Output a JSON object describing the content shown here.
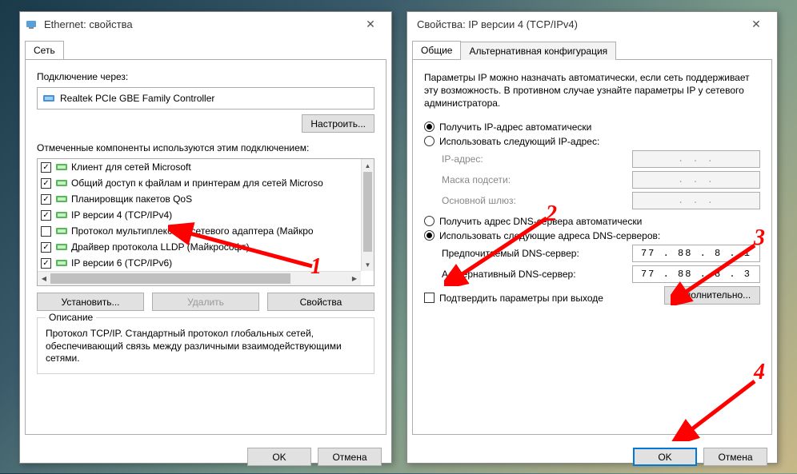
{
  "left": {
    "title": "Ethernet: свойства",
    "tab": "Сеть",
    "connect_label": "Подключение через:",
    "adapter": "Realtek PCIe GBE Family Controller",
    "configure_btn": "Настроить...",
    "components_label": "Отмеченные компоненты используются этим подключением:",
    "items": [
      {
        "chk": true,
        "label": "Клиент для сетей Microsoft"
      },
      {
        "chk": true,
        "label": "Общий доступ к файлам и принтерам для сетей Microso"
      },
      {
        "chk": true,
        "label": "Планировщик пакетов QoS"
      },
      {
        "chk": true,
        "label": "IP версии 4 (TCP/IPv4)"
      },
      {
        "chk": false,
        "label": "Протокол мультиплексора сетевого адаптера (Майкро"
      },
      {
        "chk": true,
        "label": "Драйвер протокола LLDP (Майкрософт)"
      },
      {
        "chk": true,
        "label": "IP версии 6 (TCP/IPv6)"
      }
    ],
    "install_btn": "Установить...",
    "remove_btn": "Удалить",
    "props_btn": "Свойства",
    "desc_title": "Описание",
    "desc_text": "Протокол TCP/IP. Стандартный протокол глобальных сетей, обеспечивающий связь между различными взаимодействующими сетями.",
    "ok": "OK",
    "cancel": "Отмена"
  },
  "right": {
    "title": "Свойства: IP версии 4 (TCP/IPv4)",
    "tab1": "Общие",
    "tab2": "Альтернативная конфигурация",
    "info": "Параметры IP можно назначать автоматически, если сеть поддерживает эту возможность. В противном случае узнайте параметры IP у сетевого администратора.",
    "r_ip_auto": "Получить IP-адрес автоматически",
    "r_ip_manual": "Использовать следующий IP-адрес:",
    "ip_label": "IP-адрес:",
    "mask_label": "Маска подсети:",
    "gw_label": "Основной шлюз:",
    "ip_dots": ".       .       .",
    "r_dns_auto": "Получить адрес DNS-сервера автоматически",
    "r_dns_manual": "Использовать следующие адреса DNS-серверов:",
    "dns1_label": "Предпочитаемый DNS-сервер:",
    "dns2_label": "Альтернативный DNS-сервер:",
    "dns1_value": "77 . 88 .  8  .  1",
    "dns2_value": "77 . 88 .  8  .  3",
    "confirm_chk": "Подтвердить параметры при выходе",
    "advanced_btn": "Дополнительно...",
    "ok": "OK",
    "cancel": "Отмена"
  },
  "annotations": {
    "n1": "1",
    "n2": "2",
    "n3": "3",
    "n4": "4"
  }
}
